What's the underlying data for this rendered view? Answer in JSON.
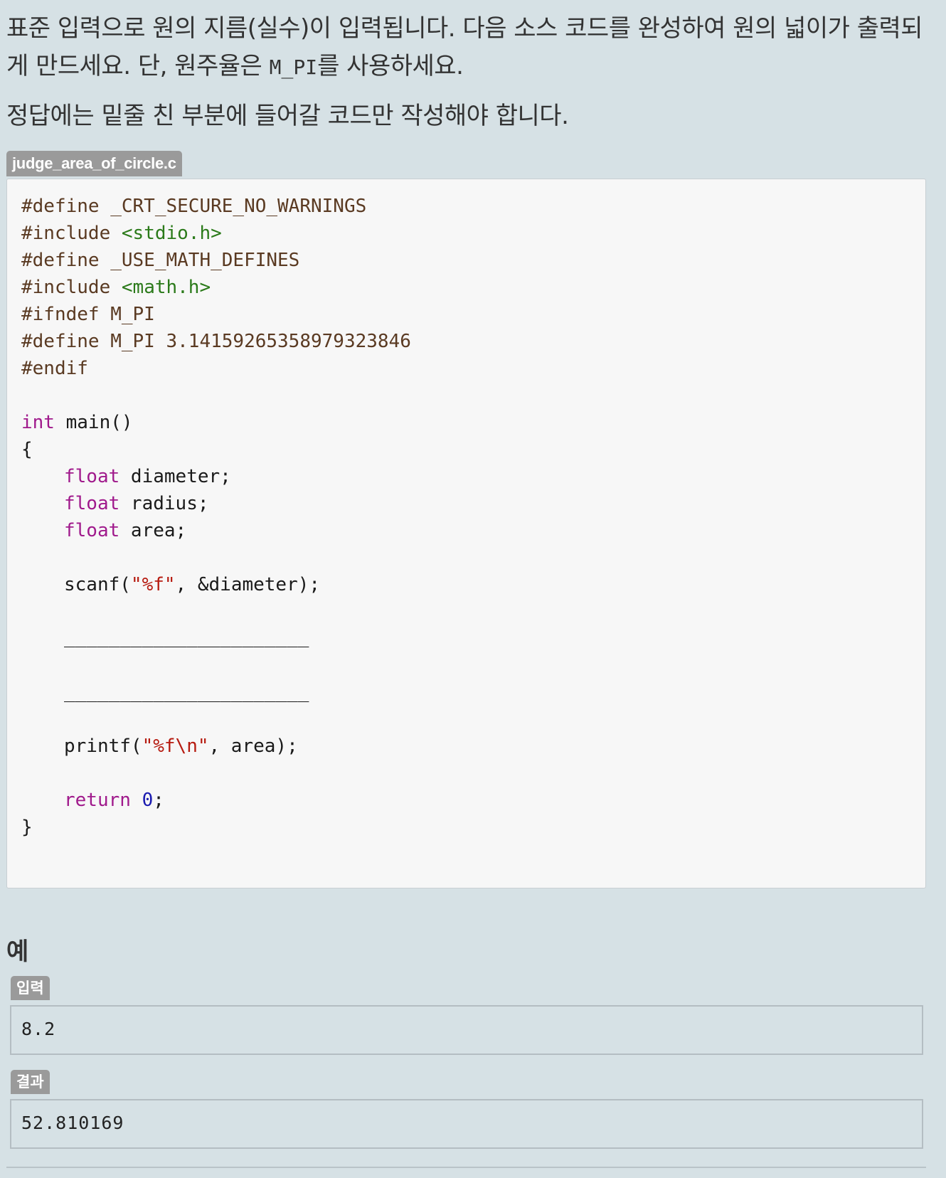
{
  "description": {
    "p1_before": "표준 입력으로 원의 지름(실수)이 입력됩니다. 다음 소스 코드를 완성하여 원의 넓이가 출력되게 만드세요. 단, 원주율은 ",
    "p1_code": "M_PI",
    "p1_after": "를 사용하세요.",
    "p2": "정답에는 밑줄 친 부분에 들어갈 코드만 작성해야 합니다."
  },
  "file": {
    "name": "judge_area_of_circle.c"
  },
  "code": {
    "l1": "#define _CRT_SECURE_NO_WARNINGS",
    "l2_a": "#include ",
    "l2_b": "<stdio.h>",
    "l3": "#define _USE_MATH_DEFINES",
    "l4_a": "#include ",
    "l4_b": "<math.h>",
    "l5": "#ifndef M_PI",
    "l6": "#define M_PI 3.14159265358979323846",
    "l7": "#endif",
    "l8_kw": "int",
    "l8_rest": " main()",
    "l9": "{",
    "l10_kw": "float",
    "l10_rest": " diameter;",
    "l11_kw": "float",
    "l11_rest": " radius;",
    "l12_kw": "float",
    "l12_rest": " area;",
    "l13_a": "scanf(",
    "l13_str": "\"%f\"",
    "l13_b": ", &diameter);",
    "blank1": "______________________",
    "blank2": "______________________",
    "l14_a": "printf(",
    "l14_str": "\"%f\\n\"",
    "l14_b": ", area);",
    "l15_kw": "return",
    "l15_num": "0",
    "l15_b": ";",
    "l16": "}"
  },
  "example": {
    "title": "예",
    "input_label": "입력",
    "input_value": "8.2",
    "output_label": "결과",
    "output_value": "52.810169"
  }
}
